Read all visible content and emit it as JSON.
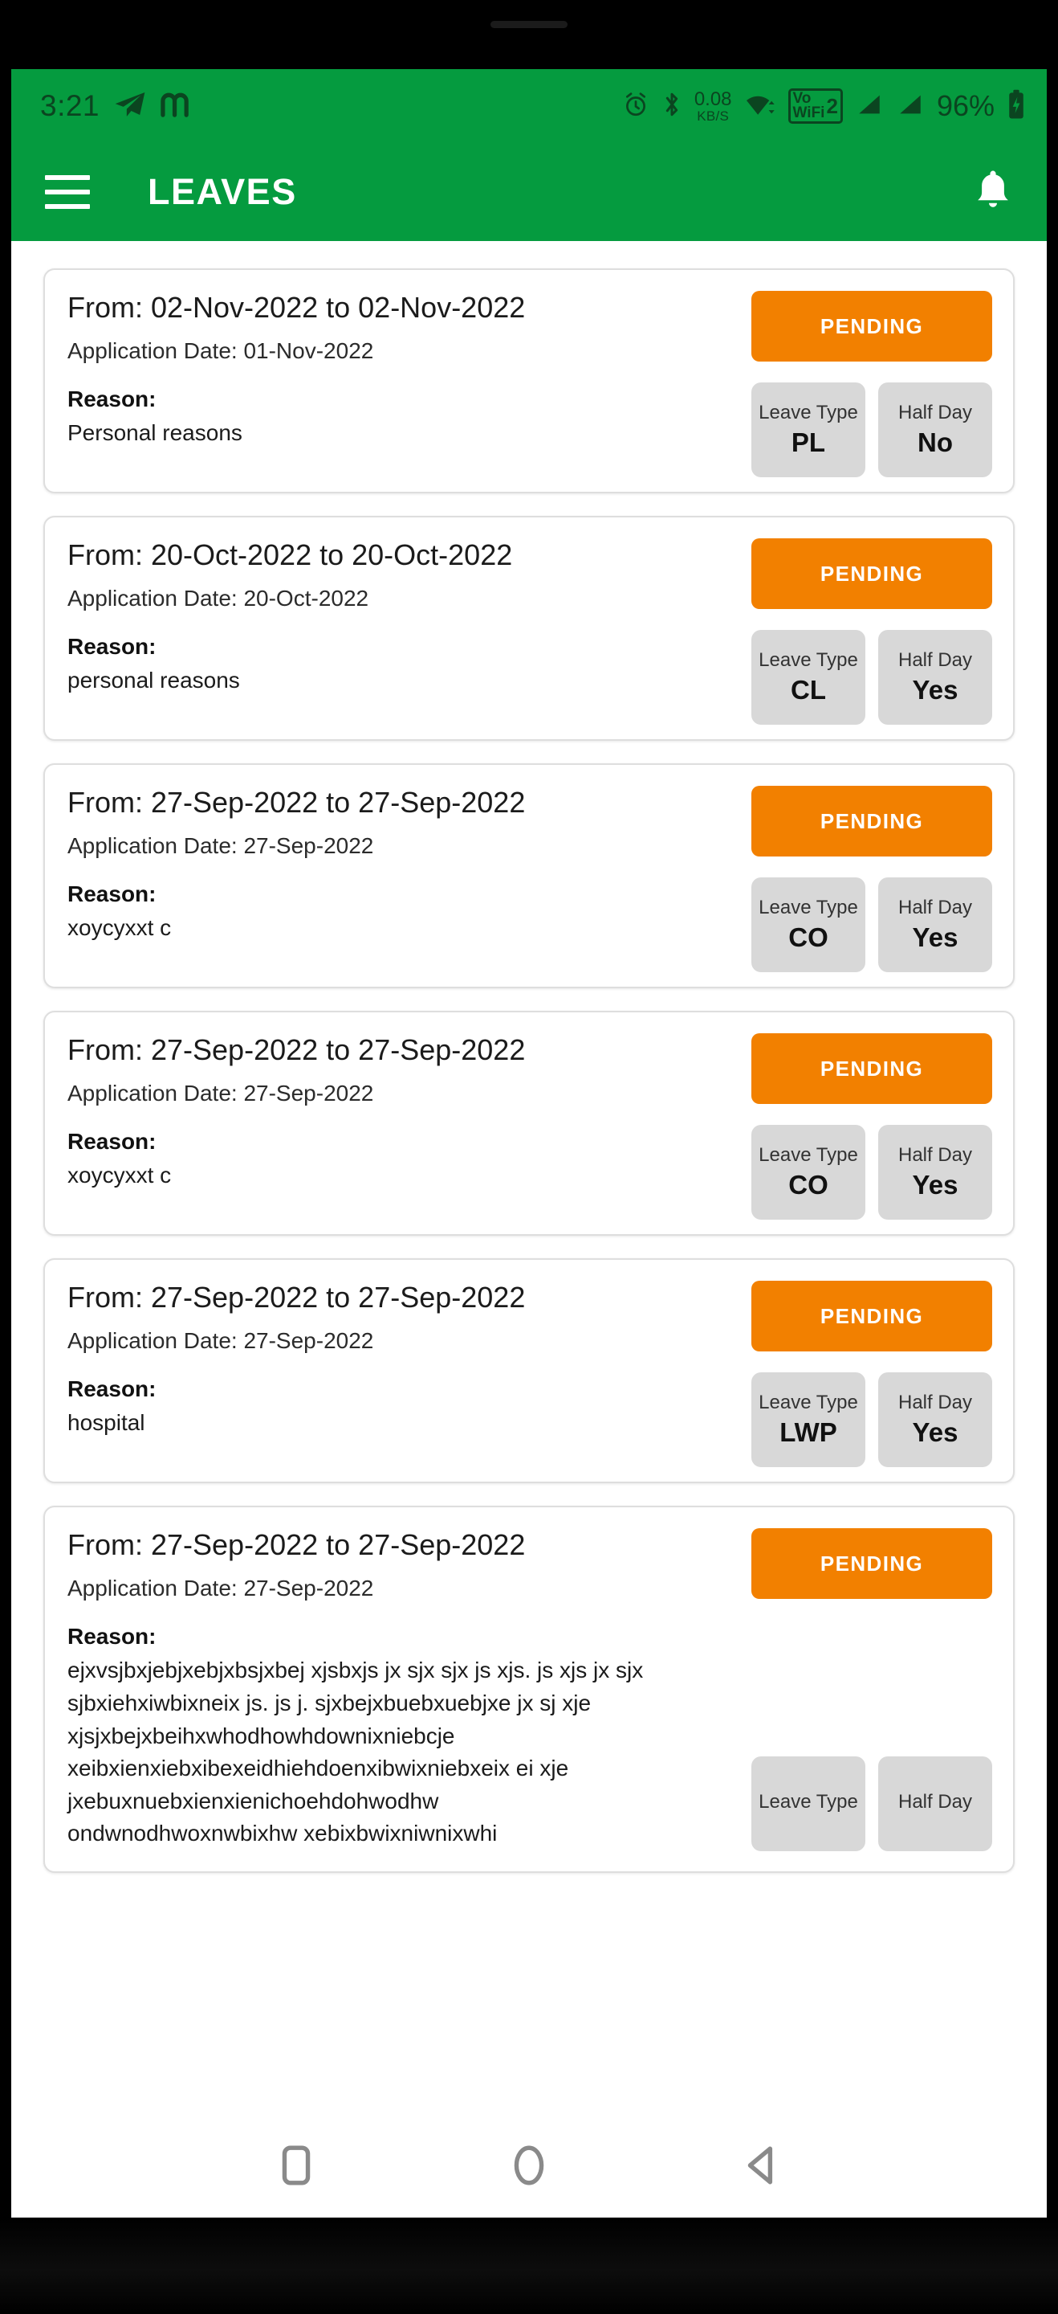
{
  "status_bar": {
    "time": "3:21",
    "left_icons": [
      "telegram-icon",
      "m-app-icon"
    ],
    "net_speed_value": "0.08",
    "net_speed_unit": "KB/S",
    "vowifi_label_top": "Vo",
    "vowifi_label_bottom": "WiFi",
    "vowifi_sim": "2",
    "battery_percent": "96%",
    "right_icons": [
      "alarm-icon",
      "bluetooth-icon",
      "wifi-icon",
      "vowifi-icon",
      "signal-1-icon",
      "signal-2-icon",
      "battery-charging-icon"
    ]
  },
  "app_bar": {
    "menu_icon": "hamburger-menu-icon",
    "title": "LEAVES",
    "notification_icon": "bell-icon"
  },
  "colors": {
    "brand_green": "#059b3f",
    "status_orange": "#f28000",
    "chip_grey": "#d8d8d8",
    "card_border": "#dedede"
  },
  "labels": {
    "from_prefix": "From:",
    "to_separator": "to",
    "application_date_prefix": "Application Date:",
    "reason_label": "Reason:",
    "leave_type_label": "Leave Type",
    "half_day_label": "Half Day"
  },
  "leaves": [
    {
      "range": "From: 02-Nov-2022 to 02-Nov-2022",
      "application_date": "Application Date: 01-Nov-2022",
      "reason_label": "Reason:",
      "reason": "Personal reasons",
      "status": "PENDING",
      "leave_type_label": "Leave Type",
      "leave_type": "PL",
      "half_day_label": "Half Day",
      "half_day": "No"
    },
    {
      "range": "From: 20-Oct-2022 to 20-Oct-2022",
      "application_date": "Application Date: 20-Oct-2022",
      "reason_label": "Reason:",
      "reason": "personal reasons",
      "status": "PENDING",
      "leave_type_label": "Leave Type",
      "leave_type": "CL",
      "half_day_label": "Half Day",
      "half_day": "Yes"
    },
    {
      "range": "From: 27-Sep-2022 to 27-Sep-2022",
      "application_date": "Application Date: 27-Sep-2022",
      "reason_label": "Reason:",
      "reason": "xoycyxxt c",
      "status": "PENDING",
      "leave_type_label": "Leave Type",
      "leave_type": "CO",
      "half_day_label": "Half Day",
      "half_day": "Yes"
    },
    {
      "range": "From: 27-Sep-2022 to 27-Sep-2022",
      "application_date": "Application Date: 27-Sep-2022",
      "reason_label": "Reason:",
      "reason": "xoycyxxt c",
      "status": "PENDING",
      "leave_type_label": "Leave Type",
      "leave_type": "CO",
      "half_day_label": "Half Day",
      "half_day": "Yes"
    },
    {
      "range": "From: 27-Sep-2022 to 27-Sep-2022",
      "application_date": "Application Date: 27-Sep-2022",
      "reason_label": "Reason:",
      "reason": "hospital",
      "status": "PENDING",
      "leave_type_label": "Leave Type",
      "leave_type": "LWP",
      "half_day_label": "Half Day",
      "half_day": "Yes"
    },
    {
      "range": "From: 27-Sep-2022 to 27-Sep-2022",
      "application_date": "Application Date: 27-Sep-2022",
      "reason_label": "Reason:",
      "reason": "ejxvsjbxjebjxebjxbsjxbej xjsbxjs jx sjx sjx js xjs. js xjs jx sjx sjbxiehxiwbixneix js. js j. sjxbejxbuebxuebjxe jx sj xje xjsjxbejxbeihxwhodhowhdownixniebcje xeibxienxiebxibexeidhiehdoenxibwixniebxeix ei xje jxebuxnuebxienxienichoehdohwodhw ondwnodhwoxnwbixhw xebixbwixniwnixwhi",
      "status": "PENDING",
      "leave_type_label": "Leave Type",
      "leave_type": "",
      "half_day_label": "Half Day",
      "half_day": ""
    }
  ],
  "nav_bar": {
    "recents_label": "recents-square-icon",
    "home_label": "home-circle-icon",
    "back_label": "back-triangle-icon"
  }
}
